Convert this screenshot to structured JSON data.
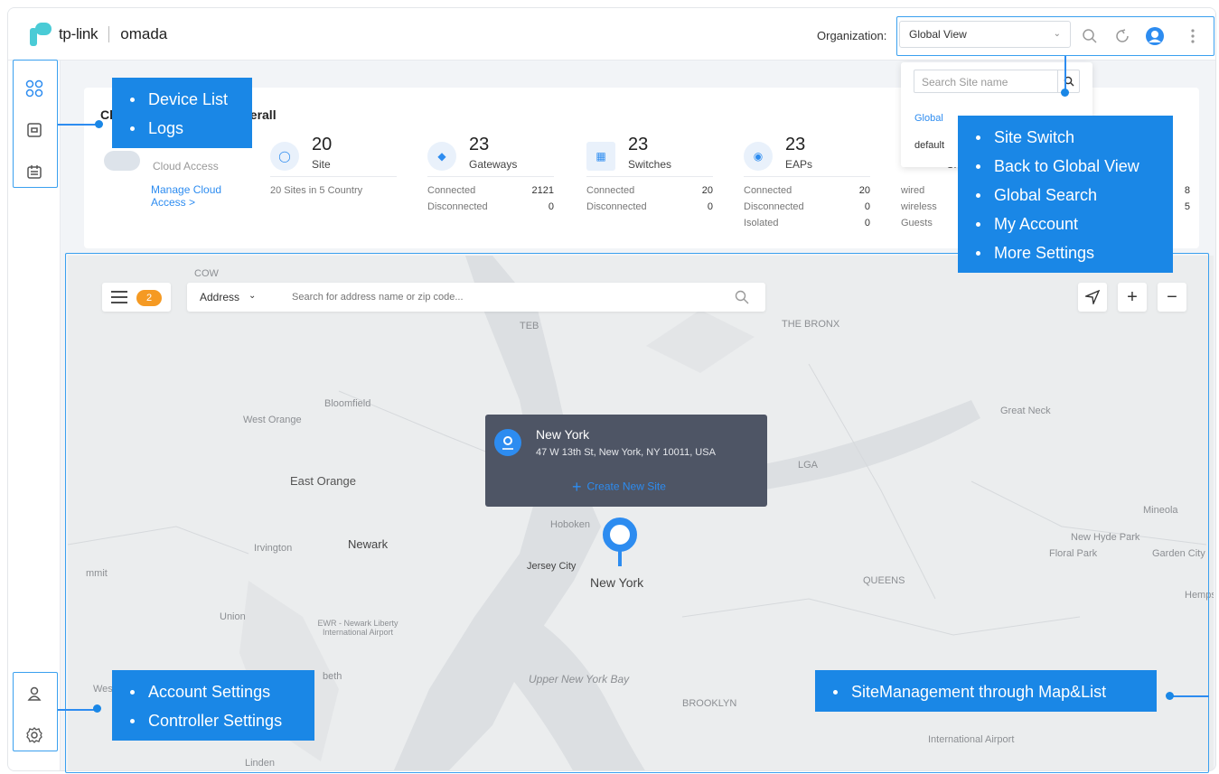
{
  "topbar": {
    "brand_tp": "tp-link",
    "brand_omada": "omada",
    "org_label": "Organization:",
    "org_value": "Global View"
  },
  "site_dropdown": {
    "search_placeholder": "Search Site name",
    "items": [
      "Global",
      "default"
    ]
  },
  "overview": {
    "title_fragment": "Cl",
    "title_tail": "verall",
    "cloud_status": "Cloud Access",
    "cloud_link_line1": "Manage Cloud",
    "cloud_link_line2": "Access >",
    "stats": [
      {
        "num": "20",
        "name": "Site",
        "rows": [
          {
            "k": "20 Sites in 5 Country",
            "v": ""
          }
        ]
      },
      {
        "num": "23",
        "name": "Gateways",
        "rows": [
          {
            "k": "Connected",
            "v": "2121"
          },
          {
            "k": "Disconnected",
            "v": "0"
          }
        ]
      },
      {
        "num": "23",
        "name": "Switches",
        "rows": [
          {
            "k": "Connected",
            "v": "20"
          },
          {
            "k": "Disconnected",
            "v": "0"
          }
        ]
      },
      {
        "num": "23",
        "name": "EAPs",
        "rows": [
          {
            "k": "Connected",
            "v": "20"
          },
          {
            "k": "Disconnected",
            "v": "0"
          },
          {
            "k": "Isolated",
            "v": "0"
          }
        ]
      },
      {
        "num": "",
        "name": "Cl",
        "rows": [
          {
            "k": "wired",
            "v": "8"
          },
          {
            "k": "wireless",
            "v": "5"
          },
          {
            "k": "Guests",
            "v": ""
          }
        ]
      }
    ]
  },
  "map": {
    "badge": "2",
    "address_type": "Address",
    "search_placeholder": "Search for address name or zip code...",
    "popup": {
      "title": "New York",
      "address": "47 W 13th St, New York, NY 10011, USA",
      "create": "Create New Site"
    },
    "labels": [
      "Bloomfield",
      "West Orange",
      "East Orange",
      "Newark",
      "Irvington",
      "Hoboken",
      "Jersey City",
      "New York",
      "Union",
      "EWR - Newark Liberty International Airport",
      "Upper New York Bay",
      "Great Neck",
      "New Hyde Park",
      "Floral Park",
      "Garden City",
      "Mineola",
      "Hempst",
      "LGA",
      "TEB",
      "COW",
      "BROOKLYN",
      "QUEENS",
      "THE BRONX",
      "International Airport",
      "Linden",
      "Westfi",
      "beth",
      "mmit",
      "Great Neck"
    ]
  },
  "annotations": {
    "top_left": [
      "Device List",
      "Logs"
    ],
    "top_right": [
      "Site Switch",
      "Back to Global View",
      "Global Search",
      "My Account",
      "More Settings"
    ],
    "bottom_left": [
      "Account Settings",
      "Controller Settings"
    ],
    "bottom_right": [
      "SiteManagement through Map&List"
    ]
  },
  "colors": {
    "accent": "#2d8cf0",
    "annotation": "#1a87e6",
    "badge": "#f59a23",
    "popup_bg": "#4e5565"
  }
}
